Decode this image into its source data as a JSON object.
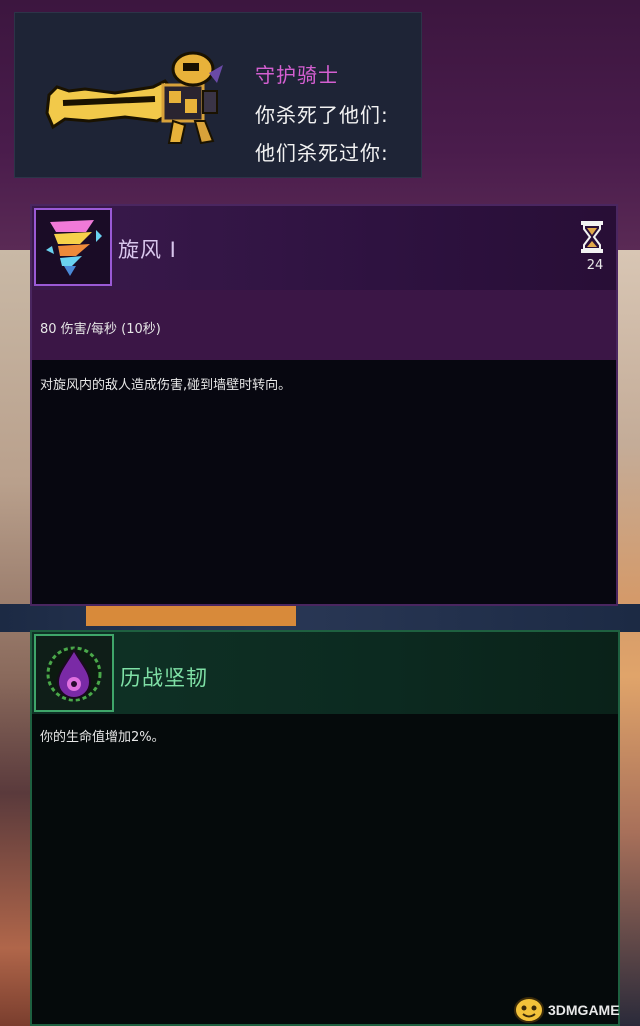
{
  "kill_panel": {
    "enemy_name": "守护骑士",
    "line1": "你杀死了他们:",
    "line2": "他们杀死过你:",
    "weapon_icon": "golden-sword-icon"
  },
  "skill_card": {
    "name": "旋风 Ⅰ",
    "icon": "whirlwind-icon",
    "cooldown_icon": "hourglass-icon",
    "cooldown": "24",
    "stat": "80 伤害/每秒 (10秒)",
    "description": "对旋风内的敌人造成伤害,碰到墙壁时转向。",
    "accent_color": "#9a5ad6"
  },
  "mutation_card": {
    "name": "历战坚韧",
    "icon": "purple-drop-icon",
    "description": "你的生命值增加2%。",
    "accent_color": "#3fa66a"
  },
  "watermark": {
    "text": "3DMGAME"
  }
}
